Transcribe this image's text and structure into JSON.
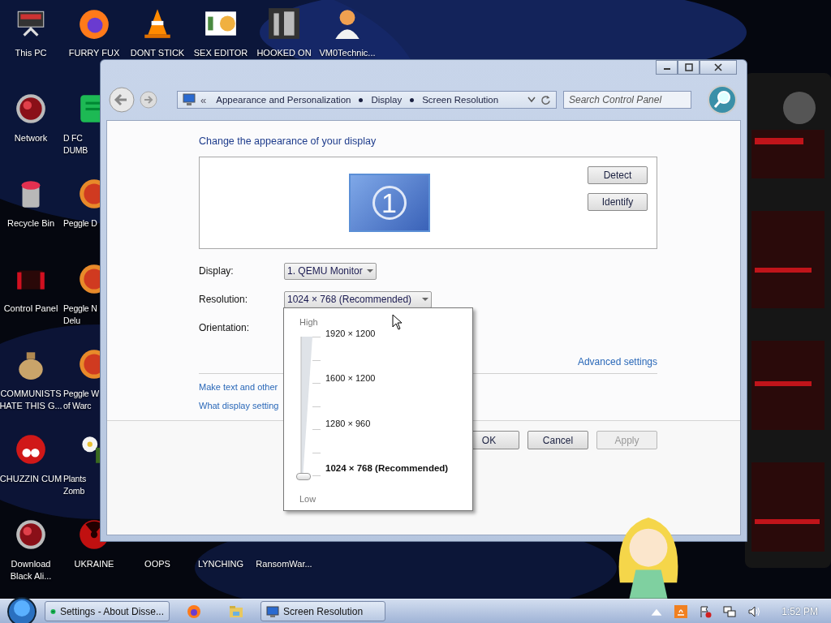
{
  "desktop_icons": [
    {
      "label": "This PC",
      "kind": "monitor"
    },
    {
      "label": "Network",
      "kind": "orb"
    },
    {
      "label": "Recycle Bin",
      "kind": "bin"
    },
    {
      "label": "Control Panel",
      "kind": "box"
    },
    {
      "label": "COMMUNISTS HATE THIS G...",
      "kind": "bag"
    },
    {
      "label": "CHUZZIN CUM",
      "kind": "fuzz"
    },
    {
      "label": "Download Black Ali...",
      "kind": "orb"
    },
    {
      "label": "FURRY FUX",
      "kind": "globe"
    },
    {
      "label": "D FC\nDUMB",
      "kind": "sheet"
    },
    {
      "label": "Peggle D",
      "kind": "ball"
    },
    {
      "label": "Peggle N\nDelu",
      "kind": "ball"
    },
    {
      "label": "Peggle W\nof Warc",
      "kind": "ball"
    },
    {
      "label": "Plants\nZomb",
      "kind": "flower"
    },
    {
      "label": "UKRAINE",
      "kind": "radiation"
    },
    {
      "label": "DONT STICK",
      "kind": "cone"
    },
    {
      "label": "OOPS",
      "kind": "hidden"
    },
    {
      "label": "SEX EDITOR",
      "kind": "tile"
    },
    {
      "label": "LYNCHING",
      "kind": "hidden"
    },
    {
      "label": "HOOKED ON",
      "kind": "maze"
    },
    {
      "label": "RansomWar...",
      "kind": "hidden"
    },
    {
      "label": "VM0Technic...",
      "kind": "person"
    }
  ],
  "window": {
    "address_bar": {
      "chevron": "«",
      "crumbs": [
        "Appearance and Personalization",
        "Display",
        "Screen Resolution"
      ]
    },
    "search": {
      "placeholder": "Search Control Panel"
    },
    "heading": "Change the appearance of your display",
    "monitor_number": "1",
    "side_buttons": [
      "Detect",
      "Identify"
    ],
    "fields": [
      {
        "label": "Display:",
        "value": "1. QEMU Monitor"
      },
      {
        "label": "Resolution:",
        "value": "1024 × 768 (Recommended)"
      },
      {
        "label": "Orientation:"
      }
    ],
    "advanced_link": "Advanced settings",
    "links": [
      "Make text and other",
      "What display setting"
    ],
    "footer_buttons": [
      {
        "label": "OK",
        "disabled": false
      },
      {
        "label": "Cancel",
        "disabled": false
      },
      {
        "label": "Apply",
        "disabled": true
      }
    ]
  },
  "resolution_popup": {
    "high_label": "High",
    "low_label": "Low",
    "level": 0,
    "options": [
      {
        "label": "1920 × 1200",
        "selected": false
      },
      {
        "label": "1600 × 1200",
        "selected": false
      },
      {
        "label": "1280 × 960",
        "selected": false
      },
      {
        "label": "1024 × 768 (Recommended)",
        "selected": true
      }
    ]
  },
  "taskbar": {
    "items": [
      {
        "kind": "app",
        "label": "Settings - About Disse..."
      },
      {
        "kind": "browser"
      },
      {
        "kind": "folder"
      },
      {
        "kind": "window",
        "label": "Screen Resolution"
      }
    ],
    "clock": "1:52 PM"
  }
}
